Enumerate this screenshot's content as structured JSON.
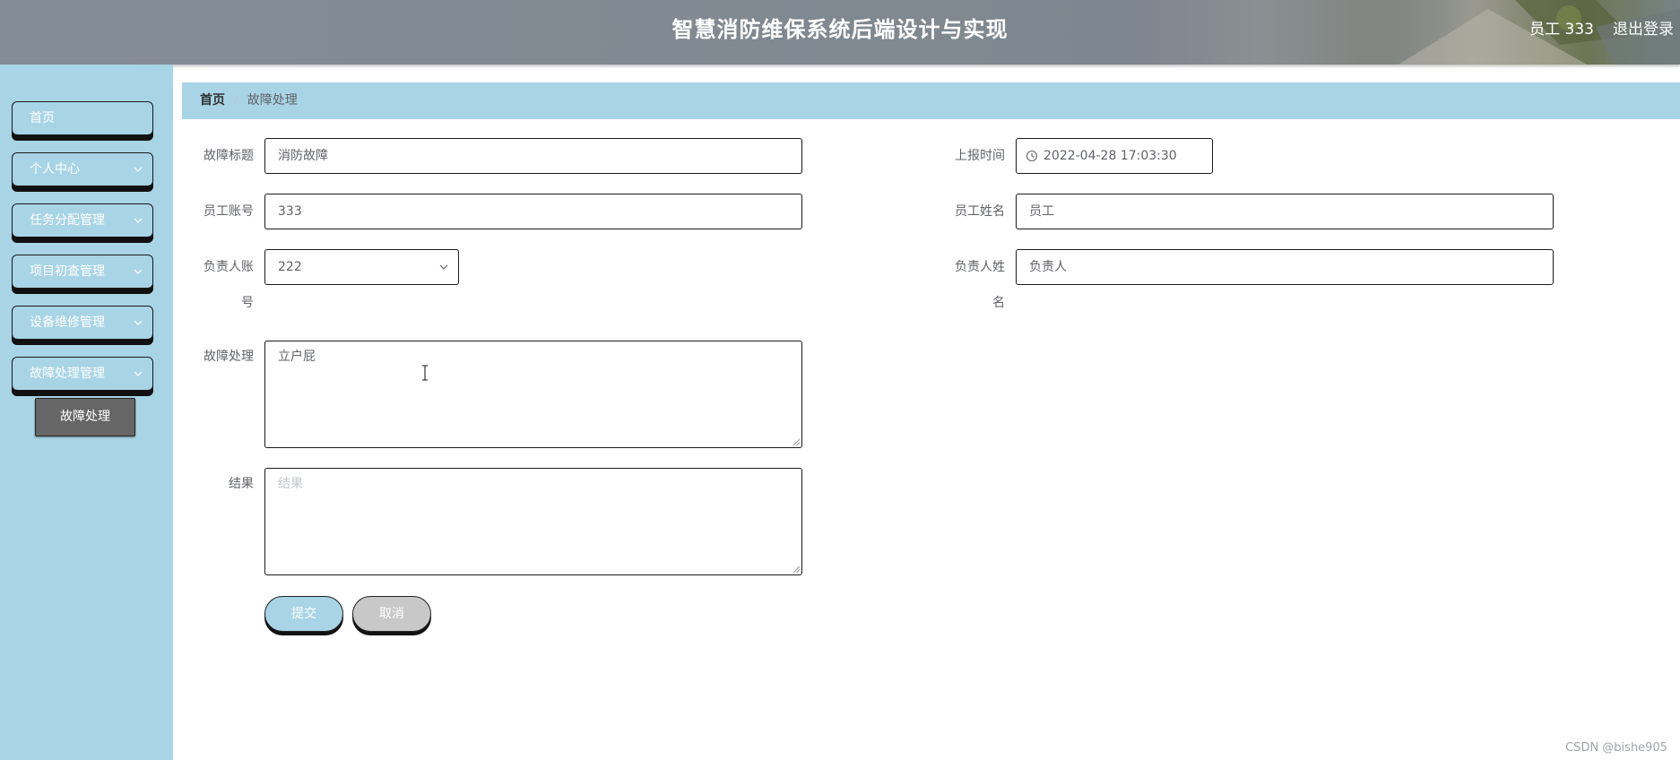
{
  "header": {
    "title": "智慧消防维保系统后端设计与实现",
    "user": "员工 333",
    "logout": "退出登录"
  },
  "sidebar": {
    "items": [
      {
        "label": "首页",
        "expandable": false
      },
      {
        "label": "个人中心",
        "expandable": true
      },
      {
        "label": "任务分配管理",
        "expandable": true
      },
      {
        "label": "项目初查管理",
        "expandable": true
      },
      {
        "label": "设备维修管理",
        "expandable": true
      },
      {
        "label": "故障处理管理",
        "expandable": true
      }
    ],
    "active_sub_item": "故障处理"
  },
  "breadcrumb": {
    "home": "首页",
    "separator": "/",
    "current": "故障处理"
  },
  "form": {
    "fault_title": {
      "label": "故障标题",
      "value": "消防故障"
    },
    "report_time": {
      "label": "上报时间",
      "value": "2022-04-28 17:03:30"
    },
    "staff_account": {
      "label": "员工账号",
      "value": "333"
    },
    "staff_name": {
      "label": "员工姓名",
      "value": "员工"
    },
    "manager_account": {
      "label_line1": "负责人账",
      "label_line2": "号",
      "value": "222"
    },
    "manager_name": {
      "label_line1": "负责人姓",
      "label_line2": "名",
      "value": "负责人"
    },
    "fault_handling": {
      "label": "故障处理",
      "value": "立户屁"
    },
    "result": {
      "label": "结果",
      "value": "",
      "placeholder": "结果"
    },
    "submit_label": "提交",
    "cancel_label": "取消"
  },
  "watermark": "CSDN @bishe905",
  "colors": {
    "sidebar_bg": "#a8d4e6",
    "header_bg": "#848c96",
    "active_sub_item_bg": "#666666",
    "submit_bg": "#a8d4e6",
    "cancel_bg": "#c8c8c8"
  }
}
